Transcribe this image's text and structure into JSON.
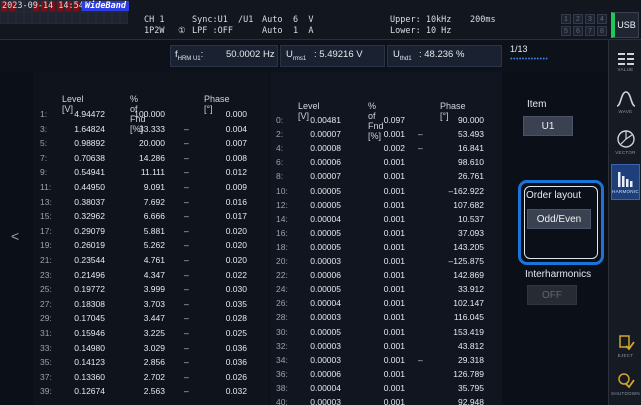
{
  "status_bar": {
    "datetime": "2023-09-14 14:54:52",
    "wideband": "WideBand",
    "ch": "CH 1",
    "ch_wiring": "1P2W",
    "wiring_num": "①",
    "sync": "Sync:U1  /U1",
    "lpf": "LPF :OFF",
    "range_mode_u": "Auto",
    "range_mode_i": "Auto",
    "range_u": "6  V",
    "range_i": "1  A",
    "upper": "Upper: 10kHz",
    "lower": "Lower: 10 Hz",
    "period": "200ms",
    "channels": [
      "1",
      "2",
      "3",
      "4",
      "5",
      "6",
      "7",
      "8"
    ],
    "usb": "USB"
  },
  "header": {
    "fharm_label": "f",
    "fharm_sub": "HRM U1",
    "fharm_value": "50.0002 Hz",
    "urms_label": "U",
    "urms_sub": "rms1",
    "urms_value": ": 5.49216 V",
    "uthd_label": "U",
    "uthd_sub": "thd1",
    "uthd_value": ": 48.236 %",
    "page": "1/13",
    "page_dots": "•••••••••••••"
  },
  "columns": {
    "level": "Level [V]",
    "pct_fnd": "% of Fnd [%]",
    "phase": "Phase [°]"
  },
  "left_table": [
    {
      "order": "1:",
      "level": "4.94472",
      "pct": "100.000",
      "sign": "",
      "phase": "0.000"
    },
    {
      "order": "3:",
      "level": "1.64824",
      "pct": "33.333",
      "sign": "–",
      "phase": "0.004"
    },
    {
      "order": "5:",
      "level": "0.98892",
      "pct": "20.000",
      "sign": "–",
      "phase": "0.007"
    },
    {
      "order": "7:",
      "level": "0.70638",
      "pct": "14.286",
      "sign": "–",
      "phase": "0.008"
    },
    {
      "order": "9:",
      "level": "0.54941",
      "pct": "11.111",
      "sign": "–",
      "phase": "0.012"
    },
    {
      "order": "11:",
      "level": "0.44950",
      "pct": "9.091",
      "sign": "–",
      "phase": "0.009"
    },
    {
      "order": "13:",
      "level": "0.38037",
      "pct": "7.692",
      "sign": "–",
      "phase": "0.016"
    },
    {
      "order": "15:",
      "level": "0.32962",
      "pct": "6.666",
      "sign": "–",
      "phase": "0.017"
    },
    {
      "order": "17:",
      "level": "0.29079",
      "pct": "5.881",
      "sign": "–",
      "phase": "0.020"
    },
    {
      "order": "19:",
      "level": "0.26019",
      "pct": "5.262",
      "sign": "–",
      "phase": "0.020"
    },
    {
      "order": "21:",
      "level": "0.23544",
      "pct": "4.761",
      "sign": "–",
      "phase": "0.020"
    },
    {
      "order": "23:",
      "level": "0.21496",
      "pct": "4.347",
      "sign": "–",
      "phase": "0.022"
    },
    {
      "order": "25:",
      "level": "0.19772",
      "pct": "3.999",
      "sign": "–",
      "phase": "0.030"
    },
    {
      "order": "27:",
      "level": "0.18308",
      "pct": "3.703",
      "sign": "–",
      "phase": "0.035"
    },
    {
      "order": "29:",
      "level": "0.17045",
      "pct": "3.447",
      "sign": "–",
      "phase": "0.028"
    },
    {
      "order": "31:",
      "level": "0.15946",
      "pct": "3.225",
      "sign": "–",
      "phase": "0.025"
    },
    {
      "order": "33:",
      "level": "0.14980",
      "pct": "3.029",
      "sign": "–",
      "phase": "0.036"
    },
    {
      "order": "35:",
      "level": "0.14123",
      "pct": "2.856",
      "sign": "–",
      "phase": "0.036"
    },
    {
      "order": "37:",
      "level": "0.13360",
      "pct": "2.702",
      "sign": "–",
      "phase": "0.026"
    },
    {
      "order": "39:",
      "level": "0.12674",
      "pct": "2.563",
      "sign": "–",
      "phase": "0.032"
    }
  ],
  "right_table": [
    {
      "order": "0:",
      "level": "0.00481",
      "pct": "0.097",
      "sign": "",
      "phase": "90.000"
    },
    {
      "order": "2:",
      "level": "0.00007",
      "pct": "0.001",
      "sign": "–",
      "phase": "53.493"
    },
    {
      "order": "4:",
      "level": "0.00008",
      "pct": "0.002",
      "sign": "–",
      "phase": "16.841"
    },
    {
      "order": "6:",
      "level": "0.00006",
      "pct": "0.001",
      "sign": "",
      "phase": "98.610"
    },
    {
      "order": "8:",
      "level": "0.00007",
      "pct": "0.001",
      "sign": "",
      "phase": "26.761"
    },
    {
      "order": "10:",
      "level": "0.00005",
      "pct": "0.001",
      "sign": "",
      "phase": "–162.922"
    },
    {
      "order": "12:",
      "level": "0.00005",
      "pct": "0.001",
      "sign": "",
      "phase": "107.682"
    },
    {
      "order": "14:",
      "level": "0.00004",
      "pct": "0.001",
      "sign": "",
      "phase": "10.537"
    },
    {
      "order": "16:",
      "level": "0.00005",
      "pct": "0.001",
      "sign": "",
      "phase": "37.093"
    },
    {
      "order": "18:",
      "level": "0.00005",
      "pct": "0.001",
      "sign": "",
      "phase": "143.205"
    },
    {
      "order": "20:",
      "level": "0.00003",
      "pct": "0.001",
      "sign": "",
      "phase": "–125.875"
    },
    {
      "order": "22:",
      "level": "0.00006",
      "pct": "0.001",
      "sign": "",
      "phase": "142.869"
    },
    {
      "order": "24:",
      "level": "0.00005",
      "pct": "0.001",
      "sign": "",
      "phase": "33.912"
    },
    {
      "order": "26:",
      "level": "0.00004",
      "pct": "0.001",
      "sign": "",
      "phase": "102.147"
    },
    {
      "order": "28:",
      "level": "0.00003",
      "pct": "0.001",
      "sign": "",
      "phase": "116.045"
    },
    {
      "order": "30:",
      "level": "0.00005",
      "pct": "0.001",
      "sign": "",
      "phase": "153.419"
    },
    {
      "order": "32:",
      "level": "0.00003",
      "pct": "0.001",
      "sign": "",
      "phase": "43.812"
    },
    {
      "order": "34:",
      "level": "0.00003",
      "pct": "0.001",
      "sign": "–",
      "phase": "29.318"
    },
    {
      "order": "36:",
      "level": "0.00006",
      "pct": "0.001",
      "sign": "",
      "phase": "126.789"
    },
    {
      "order": "38:",
      "level": "0.00004",
      "pct": "0.001",
      "sign": "",
      "phase": "35.795"
    },
    {
      "order": "40:",
      "level": "0.00003",
      "pct": "0.001",
      "sign": "",
      "phase": "92.948"
    }
  ],
  "nav": {
    "left": "<",
    "right": ">"
  },
  "panel": {
    "item_label": "Item",
    "item_value": "U1",
    "order_layout_label": "Order layout",
    "order_layout_value": "Odd/Even",
    "interharmonics_label": "Interharmonics",
    "interharmonics_value": "OFF"
  },
  "side_icons": [
    {
      "name": "value-icon",
      "label": "VALUE"
    },
    {
      "name": "wave-icon",
      "label": "WAVE"
    },
    {
      "name": "vector-icon",
      "label": "VECTOR"
    },
    {
      "name": "harmonic-icon",
      "label": "HARMONIC"
    },
    {
      "name": "eject-icon",
      "label": "EJECT"
    },
    {
      "name": "shutdown-icon",
      "label": "SHUTDOWN"
    }
  ],
  "colors": {
    "accent_blue": "#1b74d9",
    "wideband_badge": "#2b3ce0",
    "usb_ok": "#22c55e",
    "alarm_red": "#7a1018"
  }
}
